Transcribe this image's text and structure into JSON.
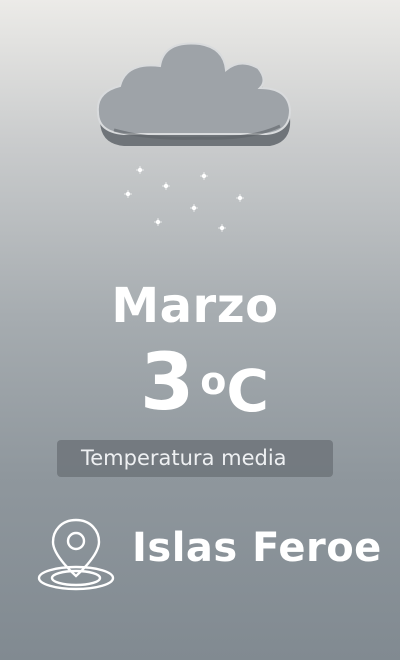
{
  "weather": {
    "icon": "snow-cloud-icon",
    "month": "Marzo",
    "temperature_value": "3",
    "temperature_degree": "o",
    "temperature_unit": "C",
    "temperature_label": "Temperatura media",
    "location_icon": "map-pin-icon",
    "location": "Islas Feroe"
  },
  "colors": {
    "text": "#ffffff",
    "label_bg": "#6e747a",
    "cloud_top": "#9ea3a8",
    "cloud_bottom": "#6d7277"
  }
}
